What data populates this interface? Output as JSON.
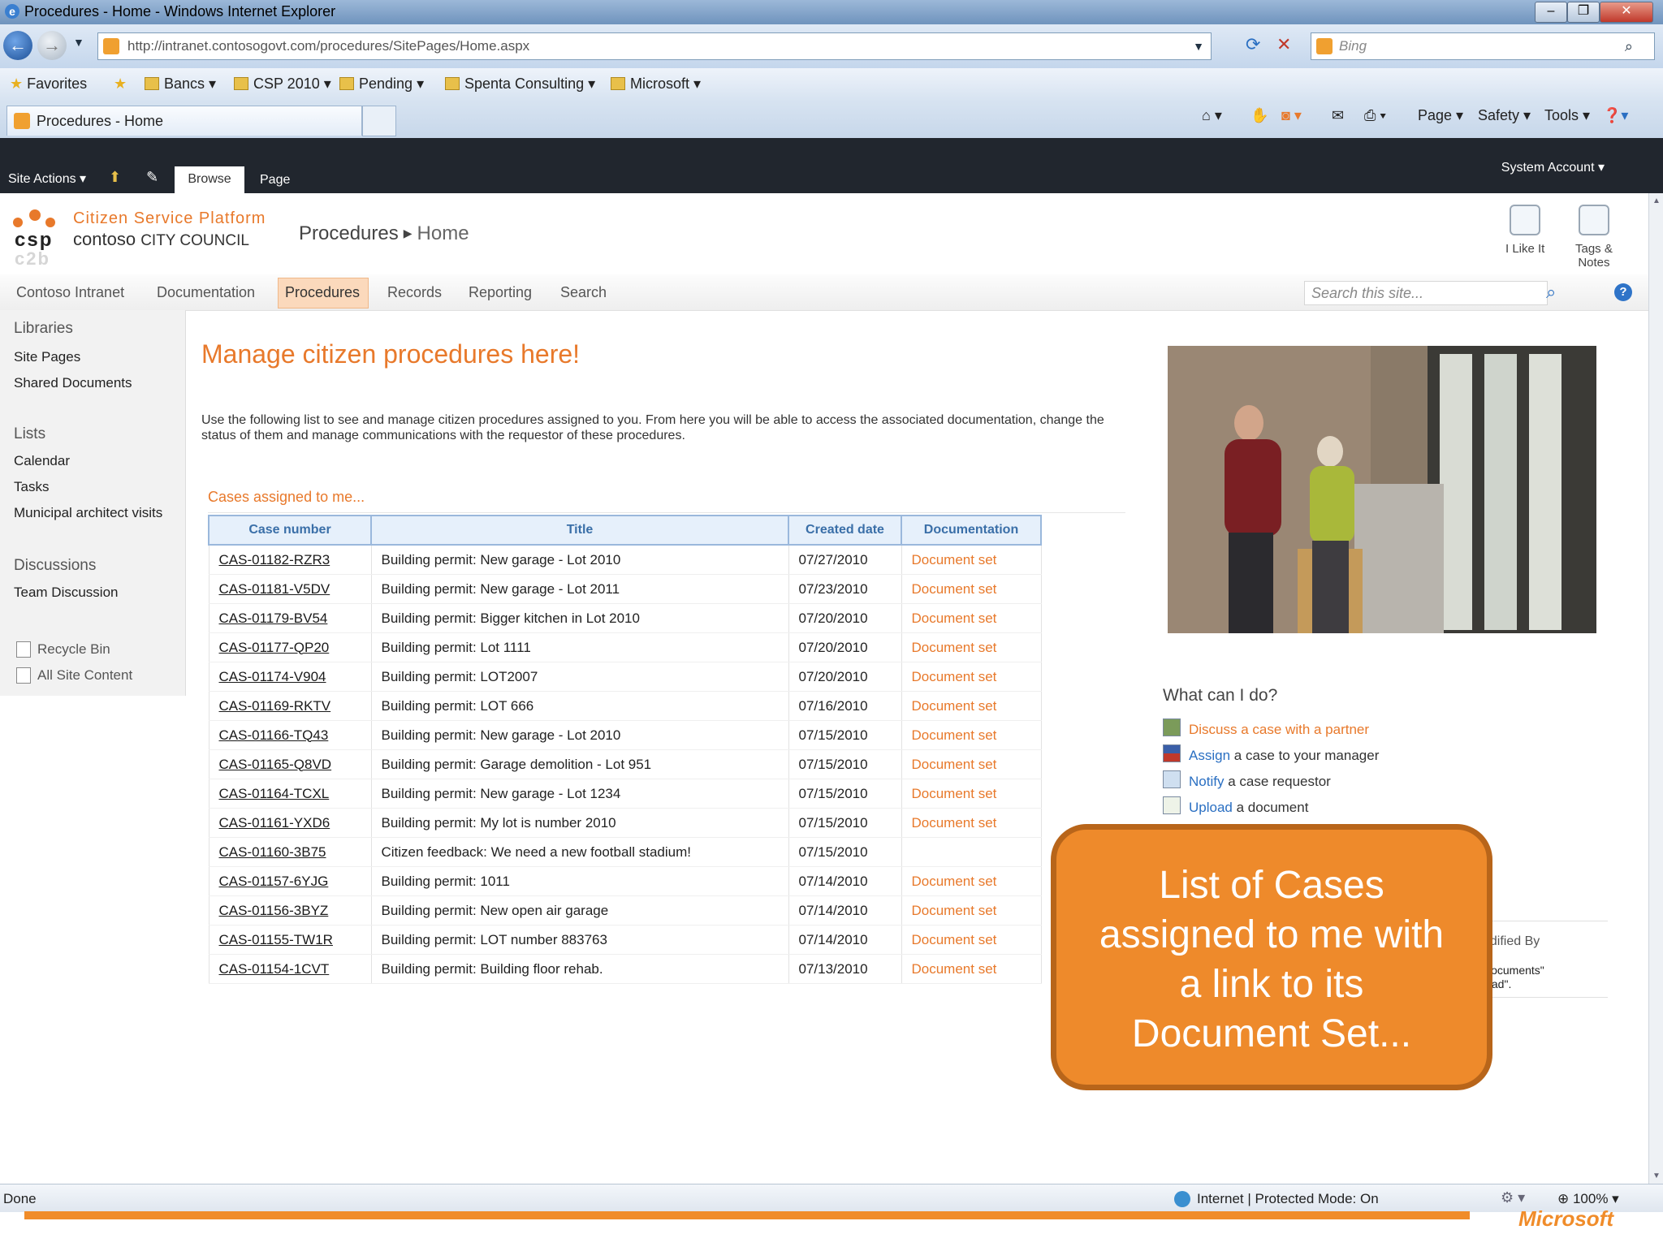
{
  "window": {
    "title": "Procedures - Home - Windows Internet Explorer",
    "min": "–",
    "max": "❐",
    "close": "✕"
  },
  "address": {
    "url": "http://intranet.contosogovt.com/procedures/SitePages/Home.aspx",
    "search_placeholder": "Bing"
  },
  "favorites": {
    "label": "Favorites",
    "folders": [
      "Bancs",
      "CSP 2010",
      "Pending",
      "Spenta Consulting",
      "Microsoft"
    ]
  },
  "browser_tab": {
    "title": "Procedures - Home",
    "commands": [
      "Page",
      "Safety",
      "Tools"
    ]
  },
  "ribbon": {
    "site_actions": "Site Actions",
    "tab_browse": "Browse",
    "tab_page": "Page",
    "user": "System Account"
  },
  "header": {
    "logo_line1": "csp",
    "logo_line2": "c2b",
    "platform": "Citizen Service Platform",
    "council_brand": "contoso",
    "council_name": "CITY COUNCIL",
    "breadcrumb_site": "Procedures",
    "breadcrumb_page": "Home",
    "like_label": "I Like It",
    "tags_label_1": "Tags &",
    "tags_label_2": "Notes"
  },
  "topnav": {
    "items": [
      "Contoso Intranet",
      "Documentation",
      "Procedures",
      "Records",
      "Reporting",
      "Search"
    ],
    "active": "Procedures",
    "search_placeholder": "Search this site..."
  },
  "leftnav": {
    "libraries": "Libraries",
    "site_pages": "Site Pages",
    "shared_documents": "Shared Documents",
    "lists": "Lists",
    "calendar": "Calendar",
    "tasks": "Tasks",
    "municipal": "Municipal architect visits",
    "discussions": "Discussions",
    "team_discussion": "Team Discussion",
    "recycle_bin": "Recycle Bin",
    "all_site_content": "All Site Content"
  },
  "main": {
    "welcome": "Manage citizen procedures here!",
    "intro": "Use the following list to see and manage citizen procedures assigned to you. From here you will be able to access the associated documentation, change the status of them and manage communications with the requestor of these procedures.",
    "cases_title": "Cases assigned to me...",
    "columns": [
      "Case number",
      "Title",
      "Created date",
      "Documentation"
    ],
    "rows": [
      [
        "CAS-01182-RZR3",
        "Building permit: New garage - Lot 2010",
        "07/27/2010",
        "Document set"
      ],
      [
        "CAS-01181-V5DV",
        "Building permit: New garage - Lot 2011",
        "07/23/2010",
        "Document set"
      ],
      [
        "CAS-01179-BV54",
        "Building permit: Bigger kitchen in Lot 2010",
        "07/20/2010",
        "Document set"
      ],
      [
        "CAS-01177-QP20",
        "Building permit: Lot 1111",
        "07/20/2010",
        "Document set"
      ],
      [
        "CAS-01174-V904",
        "Building permit: LOT2007",
        "07/20/2010",
        "Document set"
      ],
      [
        "CAS-01169-RKTV",
        "Building permit: LOT 666",
        "07/16/2010",
        "Document set"
      ],
      [
        "CAS-01166-TQ43",
        "Building permit: New garage - Lot 2010",
        "07/15/2010",
        "Document set"
      ],
      [
        "CAS-01165-Q8VD",
        "Building permit: Garage demolition - Lot 951",
        "07/15/2010",
        "Document set"
      ],
      [
        "CAS-01164-TCXL",
        "Building permit: New garage - Lot 1234",
        "07/15/2010",
        "Document set"
      ],
      [
        "CAS-01161-YXD6",
        "Building permit: My lot is number 2010",
        "07/15/2010",
        "Document set"
      ],
      [
        "CAS-01160-3B75",
        "Citizen feedback: We need a new football stadium!",
        "07/15/2010",
        ""
      ],
      [
        "CAS-01157-6YJG",
        "Building permit: 1011",
        "07/14/2010",
        "Document set"
      ],
      [
        "CAS-01156-3BYZ",
        "Building permit: New open air garage",
        "07/14/2010",
        "Document set"
      ],
      [
        "CAS-01155-TW1R",
        "Building permit: LOT number 883763",
        "07/14/2010",
        "Document set"
      ],
      [
        "CAS-01154-1CVT",
        "Building permit: Building floor rehab.",
        "07/13/2010",
        "Document set"
      ]
    ]
  },
  "actions": {
    "title": "What can I do?",
    "discuss": "Discuss a case with a partner",
    "assign_link": "Assign",
    "assign_rest": "a case to your manager",
    "notify_link": "Notify",
    "notify_rest": "a case requestor",
    "upload_link": "Upload",
    "upload_rest": "a document"
  },
  "partial_webpart": {
    "modified_by": "odified By",
    "line1": "Documents\"",
    "line2": "load\"."
  },
  "callout": {
    "text_line1": "List of Cases",
    "text_line2": "assigned to me with",
    "text_line3": "a link to its",
    "text_line4": "Document Set..."
  },
  "status": {
    "done": "Done",
    "zone": "Internet | Protected Mode: On",
    "zoom": "100%",
    "brand": "Microsoft"
  }
}
